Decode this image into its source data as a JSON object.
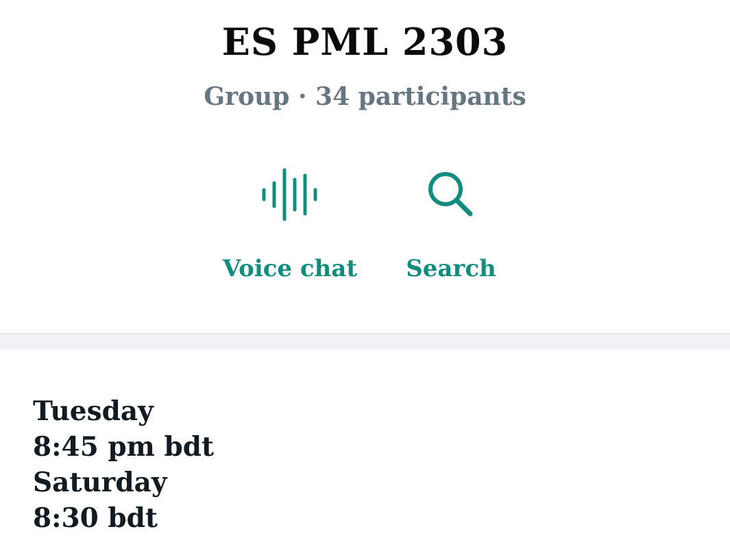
{
  "group": {
    "title": "ES PML 2303",
    "subtitle": "Group · 34 participants"
  },
  "actions": [
    {
      "label": "Voice chat",
      "icon": "voice-wave-icon"
    },
    {
      "label": "Search",
      "icon": "search-icon"
    }
  ],
  "description": {
    "lines": [
      "Tuesday",
      "8:45 pm bdt",
      "Saturday",
      "8:30 bdt"
    ]
  },
  "colors": {
    "accent": "#128c7e",
    "title": "#0b0b0b",
    "subtitle": "#667781",
    "text": "#111b21",
    "divider": "#f0f2f5"
  }
}
